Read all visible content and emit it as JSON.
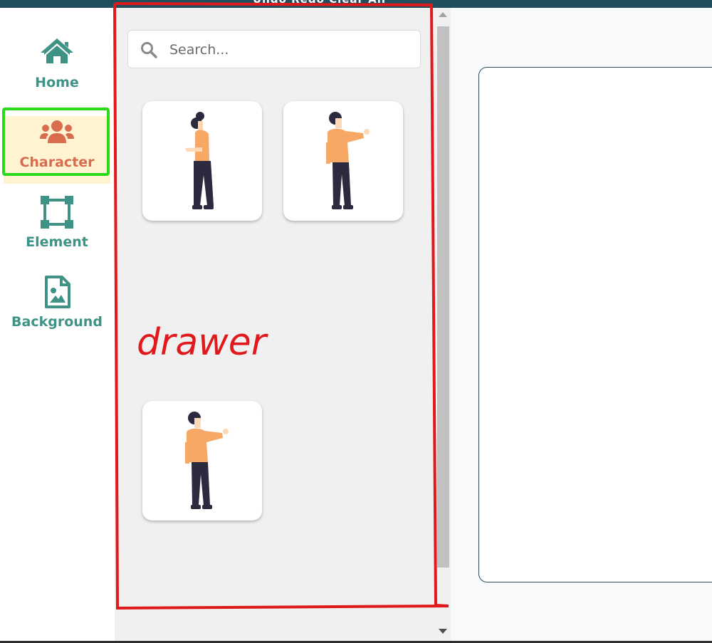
{
  "topbar": {
    "text": "Undo   Redo   Clear All"
  },
  "sidebar": {
    "items": [
      {
        "label": "Home",
        "icon": "home-icon",
        "active": false
      },
      {
        "label": "Character",
        "icon": "users-icon",
        "active": true
      },
      {
        "label": "Element",
        "icon": "vector-square-icon",
        "active": false
      },
      {
        "label": "Background",
        "icon": "file-image-icon",
        "active": false
      }
    ]
  },
  "drawer": {
    "search": {
      "placeholder": "Search..."
    },
    "characters": [
      {
        "name": "woman-standing",
        "icon": "character-woman"
      },
      {
        "name": "man-pointing",
        "icon": "character-man"
      },
      {
        "name": "man-pointing-2",
        "icon": "character-man"
      }
    ]
  },
  "annotations": {
    "drawer_label": "drawer"
  },
  "colors": {
    "topbar": "#1f4e5c",
    "nav_text": "#3f9286",
    "active_text": "#d96c4c",
    "active_bg": "#fff3d1",
    "highlight": "#2bd81a",
    "annotation": "#e0191c",
    "drawer_bg": "#f0f0f0",
    "shirt": "#f7a866",
    "pants": "#2b2a3f"
  }
}
